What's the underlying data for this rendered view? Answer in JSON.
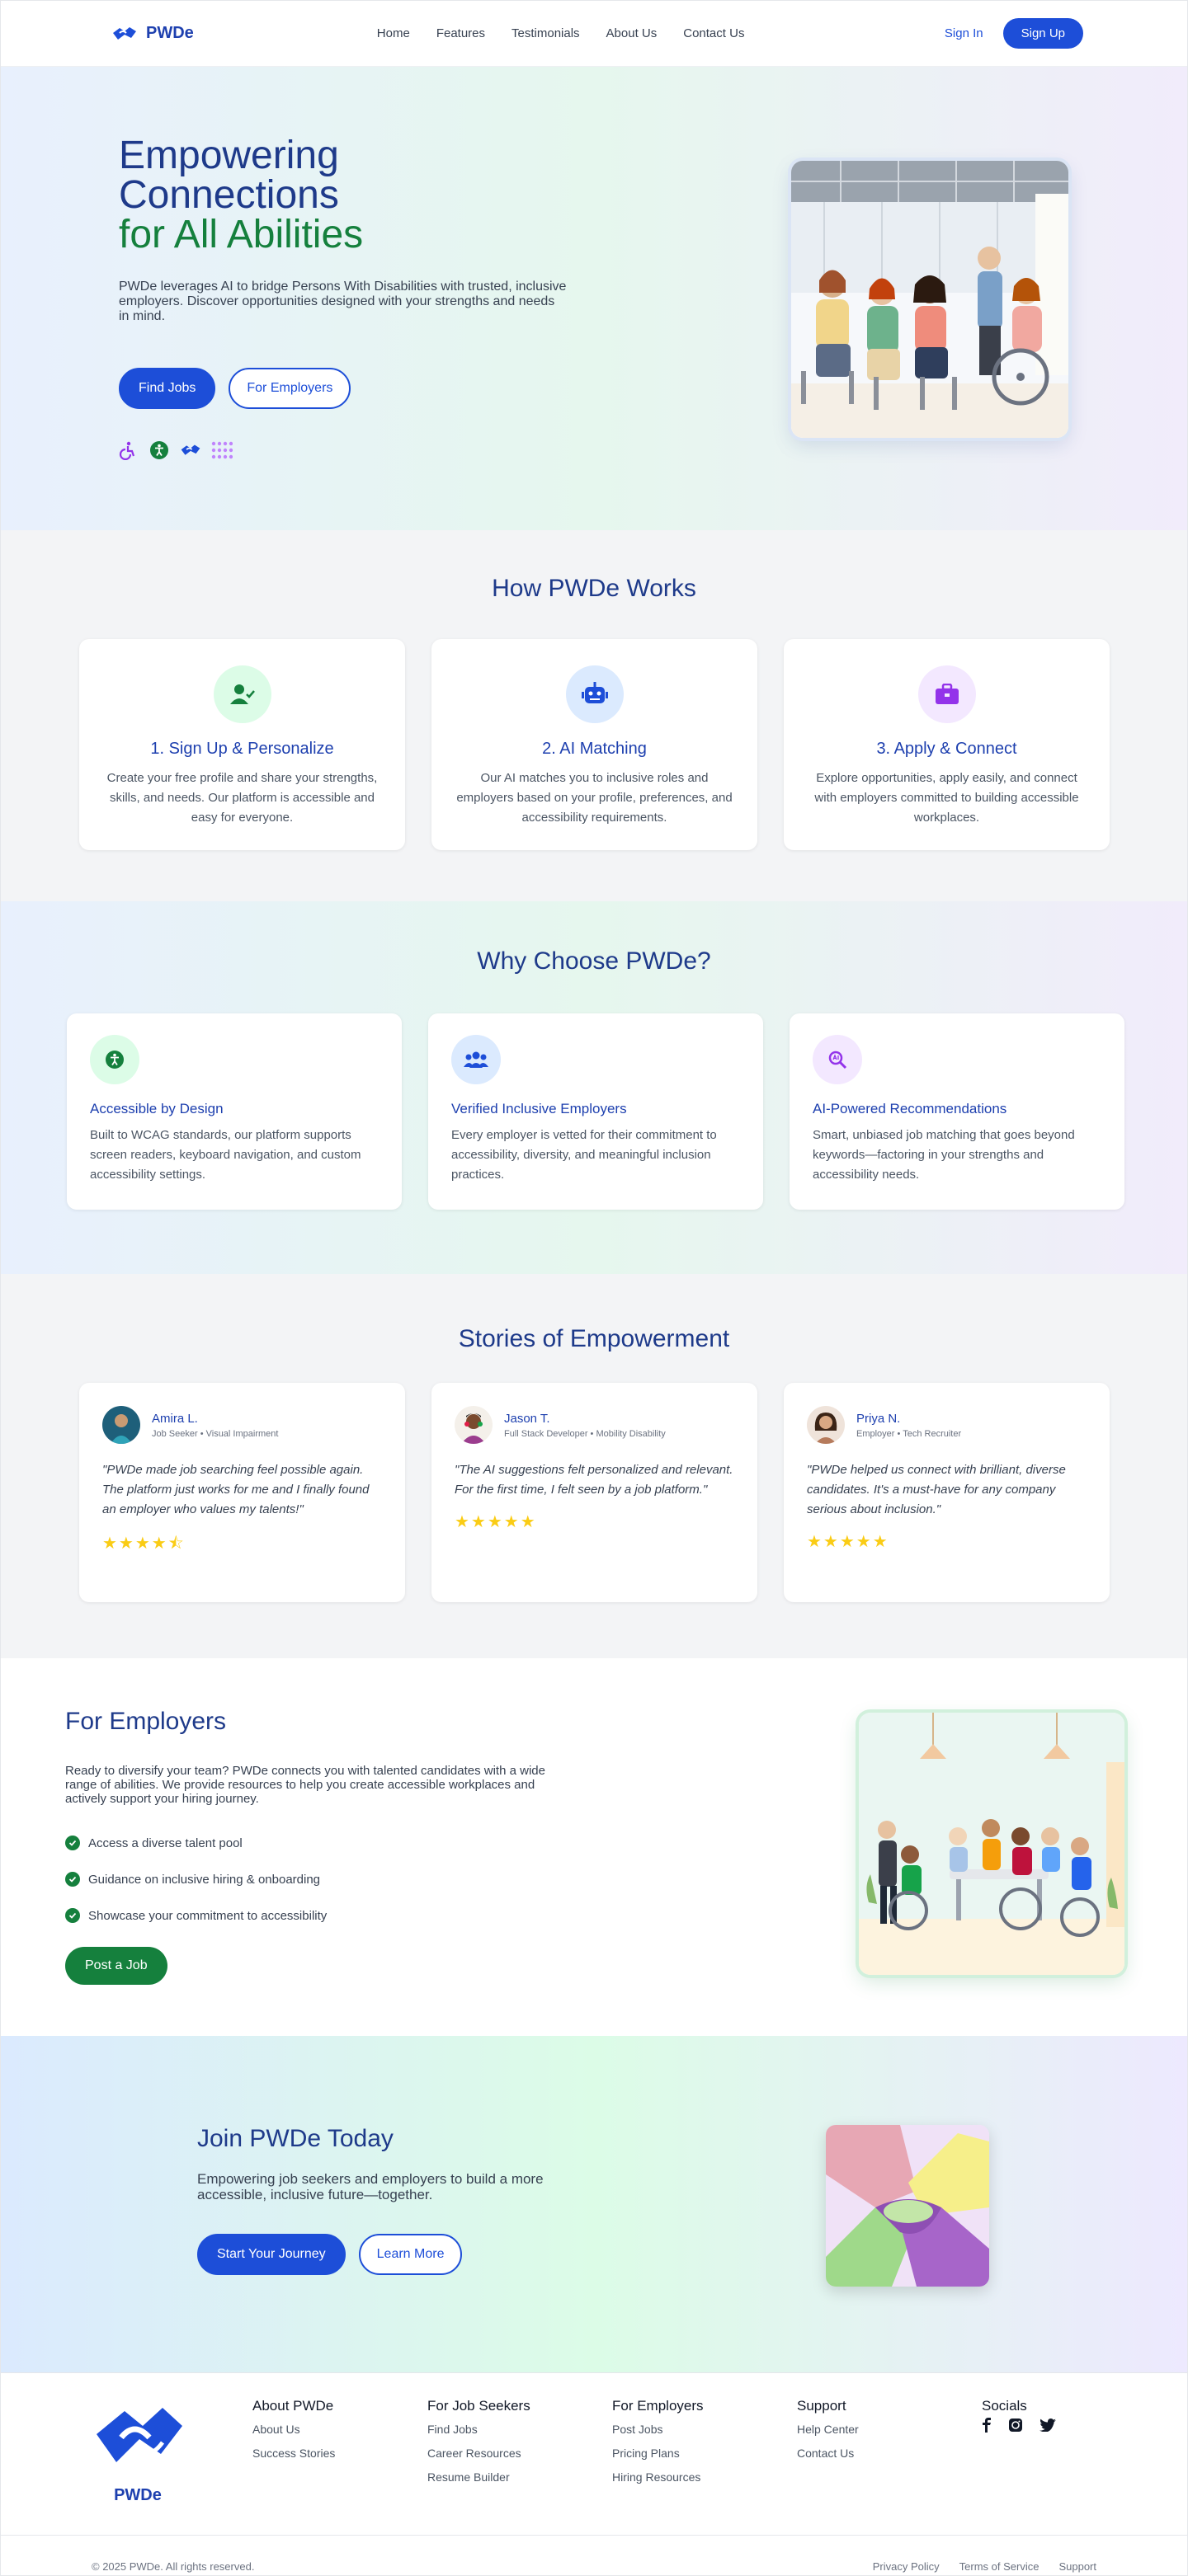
{
  "header": {
    "brand": "PWDe",
    "nav": [
      "Home",
      "Features",
      "Testimonials",
      "About Us",
      "Contact Us"
    ],
    "signin": "Sign In",
    "signup": "Sign Up"
  },
  "hero": {
    "title_line1": "Empowering",
    "title_line2": "Connections",
    "title_accent": "for All Abilities",
    "description": "PWDe leverages AI to bridge Persons With Disabilities with trusted, inclusive employers. Discover opportunities designed with your strengths and needs in mind.",
    "primary_button": "Find Jobs",
    "secondary_button": "For Employers",
    "icons": [
      "wheelchair-icon",
      "accessibility-icon",
      "handshake-icon",
      "braille-grid-icon"
    ]
  },
  "how": {
    "title": "How PWDe Works",
    "cards": [
      {
        "title": "1. Sign Up & Personalize",
        "text": "Create your free profile and share your strengths, skills, and needs. Our platform is accessible and easy for everyone.",
        "icon": "user-check-icon"
      },
      {
        "title": "2. AI Matching",
        "text": "Our AI matches you to inclusive roles and employers based on your profile, preferences, and accessibility requirements.",
        "icon": "robot-icon"
      },
      {
        "title": "3. Apply & Connect",
        "text": "Explore opportunities, apply easily, and connect with employers committed to building accessible workplaces.",
        "icon": "briefcase-icon"
      }
    ]
  },
  "why": {
    "title": "Why Choose PWDe?",
    "cards": [
      {
        "title": "Accessible by Design",
        "text": "Built to WCAG standards, our platform supports screen readers, keyboard navigation, and custom accessibility settings.",
        "icon": "accessibility-icon"
      },
      {
        "title": "Verified Inclusive Employers",
        "text": "Every employer is vetted for their commitment to accessibility, diversity, and meaningful inclusion practices.",
        "icon": "users-icon"
      },
      {
        "title": "AI-Powered Recommendations",
        "text": "Smart, unbiased job matching that goes beyond keywords—factoring in your strengths and accessibility needs.",
        "icon": "search-ai-icon"
      }
    ]
  },
  "stories": {
    "title": "Stories of Empowerment",
    "cards": [
      {
        "name": "Amira L.",
        "role": "Job Seeker • Visual Impairment",
        "quote": "\"PWDe made job searching feel possible again. The platform just works for me and I finally found an employer who values my talents!\"",
        "rating": 4.5,
        "stars": "★★★★⯪"
      },
      {
        "name": "Jason T.",
        "role": "Full Stack Developer • Mobility Disability",
        "quote": "\"The AI suggestions felt personalized and relevant. For the first time, I felt seen by a job platform.\"",
        "rating": 5,
        "stars": "★★★★★"
      },
      {
        "name": "Priya N.",
        "role": "Employer • Tech Recruiter",
        "quote": "\"PWDe helped us connect with brilliant, diverse candidates. It's a must-have for any company serious about inclusion.\"",
        "rating": 5,
        "stars": "★★★★★"
      }
    ]
  },
  "employers": {
    "title": "For Employers",
    "description": "Ready to diversify your team? PWDe connects you with talented candidates with a wide range of abilities. We provide resources to help you create accessible workplaces and actively support your hiring journey.",
    "bullets": [
      "Access a diverse talent pool",
      "Guidance on inclusive hiring & onboarding",
      "Showcase your commitment to accessibility"
    ],
    "button": "Post a Job"
  },
  "join": {
    "title": "Join PWDe Today",
    "description": "Empowering job seekers and employers to build a more accessible, inclusive future—together.",
    "primary_button": "Start Your Journey",
    "secondary_button": "Learn More"
  },
  "footer": {
    "brand": "PWDe",
    "columns": [
      {
        "title": "About PWDe",
        "links": [
          "About Us",
          "Success Stories"
        ]
      },
      {
        "title": "For Job Seekers",
        "links": [
          "Find Jobs",
          "Career Resources",
          "Resume Builder"
        ]
      },
      {
        "title": "For Employers",
        "links": [
          "Post Jobs",
          "Pricing Plans",
          "Hiring Resources"
        ]
      },
      {
        "title": "Support",
        "links": [
          "Help Center",
          "Contact Us"
        ]
      }
    ],
    "socials_title": "Socials",
    "socials": [
      "facebook-icon",
      "instagram-icon",
      "twitter-icon"
    ],
    "copyright": "© 2025 PWDe. All rights reserved.",
    "legal": [
      "Privacy Policy",
      "Terms of Service",
      "Support"
    ]
  },
  "colors": {
    "primary": "#1d4ed8",
    "navy": "#1e3a8a",
    "green": "#15803d",
    "purple": "#9333ea",
    "star": "#facc15"
  }
}
